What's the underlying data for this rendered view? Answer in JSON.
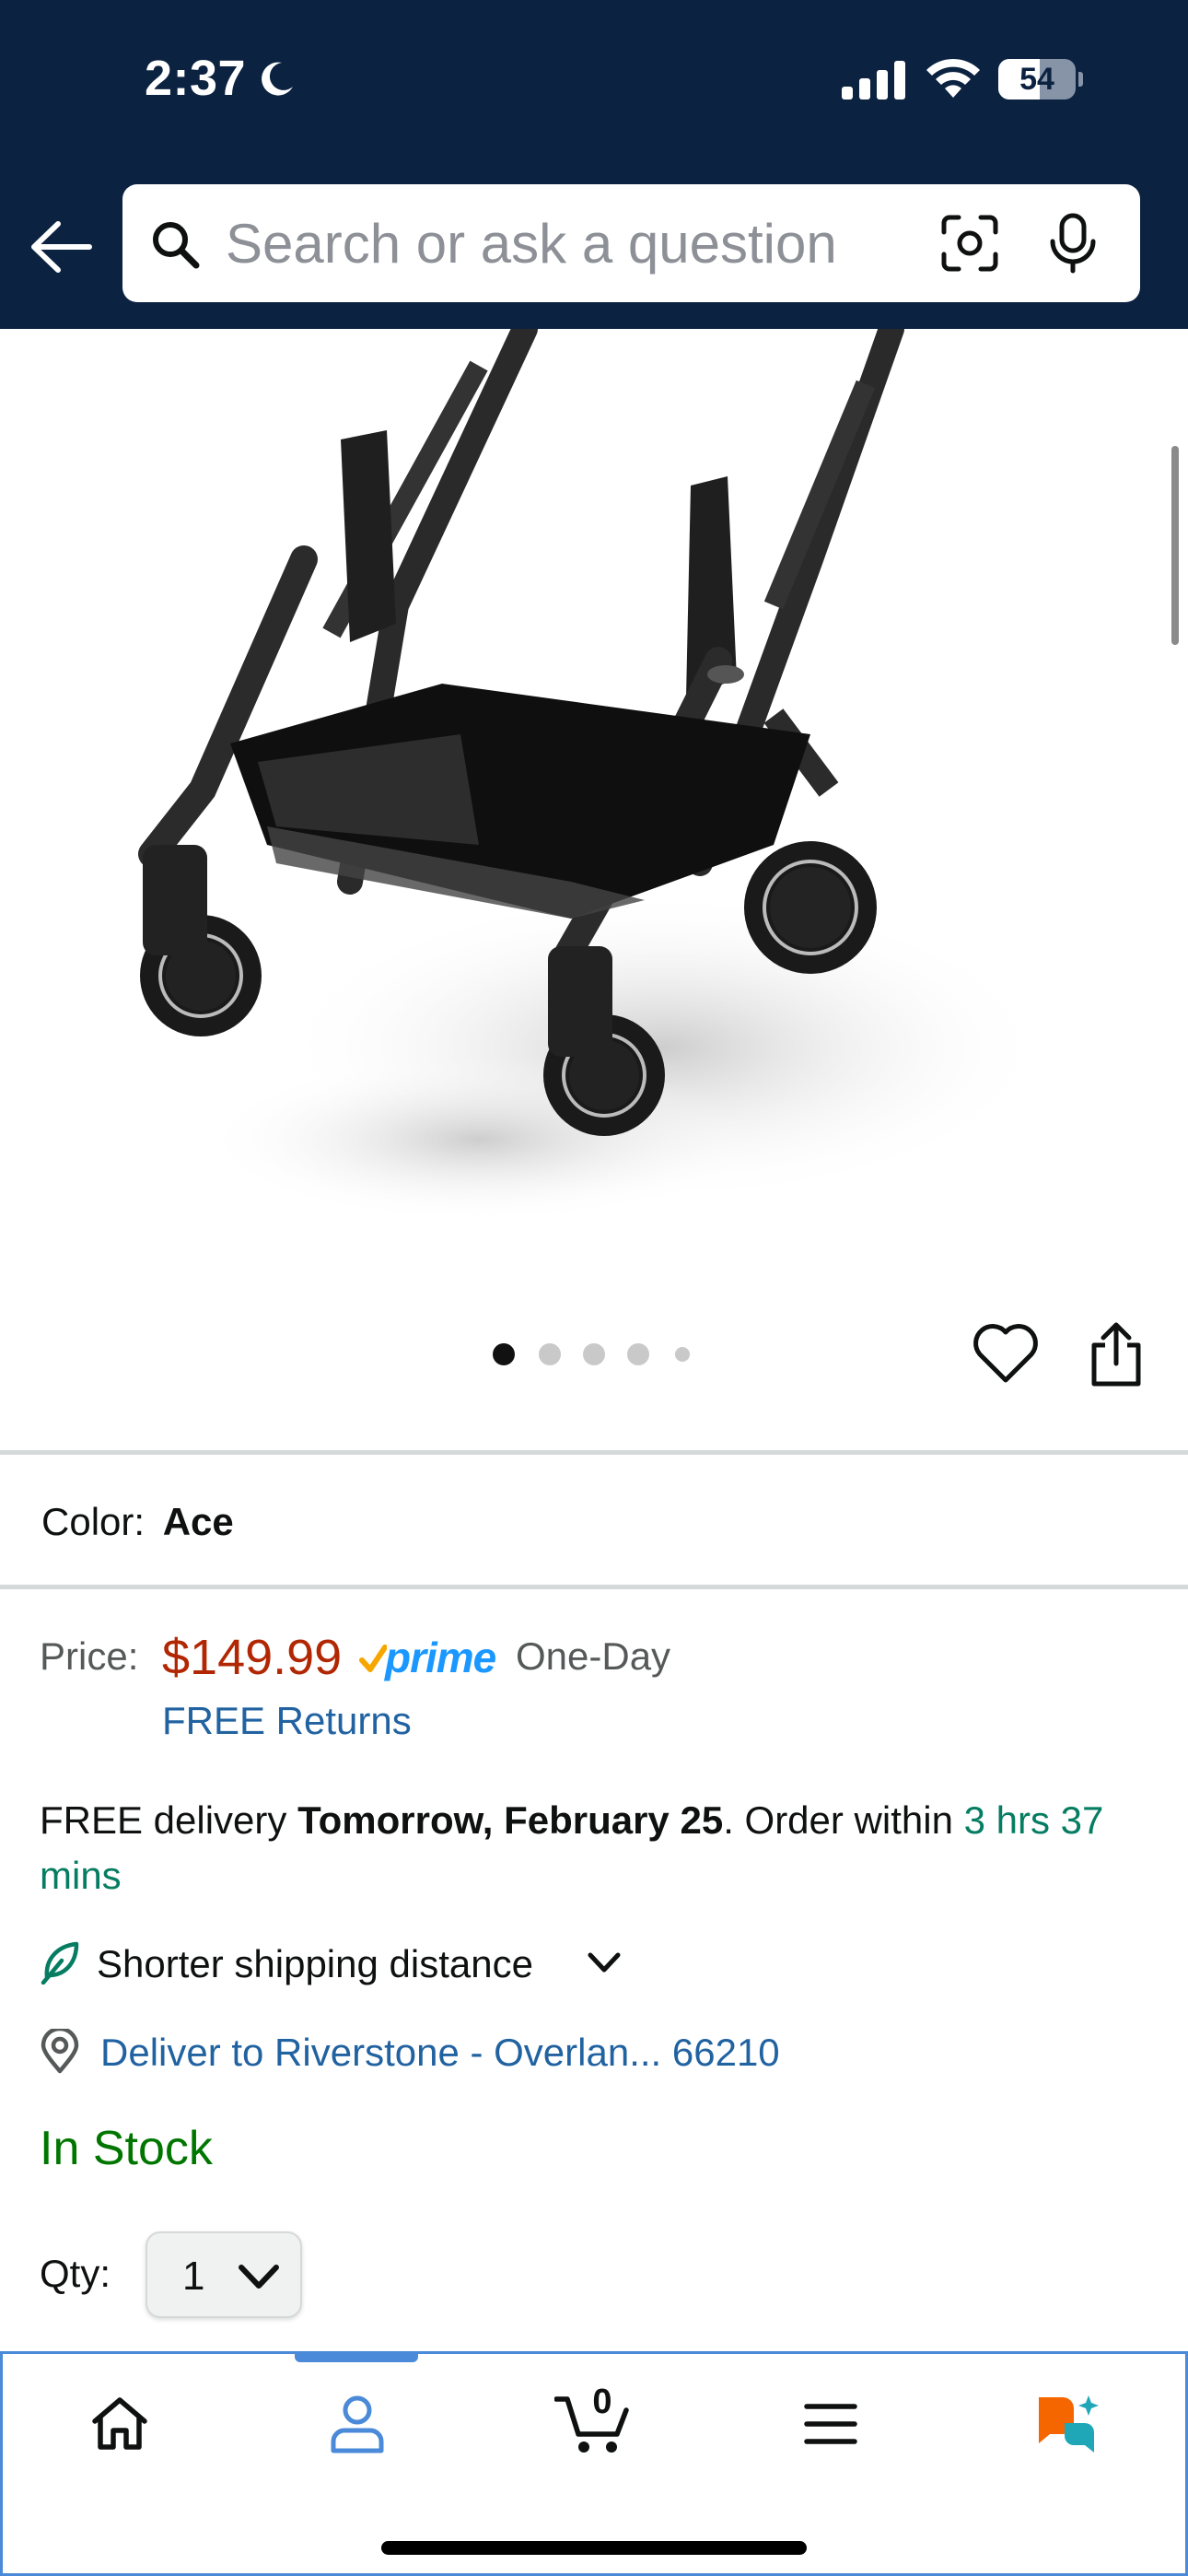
{
  "status_bar": {
    "time": "2:37",
    "battery": "54",
    "battery_level": 0.54
  },
  "search": {
    "placeholder": "Search or ask a question"
  },
  "gallery": {
    "image_count": 5,
    "active_index": 0
  },
  "product": {
    "color_label": "Color:",
    "color_value": "Ace"
  },
  "price": {
    "label": "Price:",
    "amount": "$149.99",
    "prime_label": "prime",
    "one_day": "One-Day",
    "free_returns": "FREE Returns"
  },
  "delivery": {
    "prefix": "FREE delivery ",
    "date": "Tomorrow, February 25",
    "middle": ". Order within ",
    "countdown": "3 hrs 37 mins"
  },
  "shipping": {
    "label": "Shorter shipping distance"
  },
  "deliver_to": {
    "label": "Deliver to Riverstone - Overlan... 66210"
  },
  "stock": {
    "status": "In Stock"
  },
  "quantity": {
    "label": "Qty:",
    "value": "1"
  },
  "bottom_nav": {
    "cart_count": "0",
    "active": "account"
  },
  "colors": {
    "header_bg": "#0c2241",
    "price_red": "#b12704",
    "link_blue": "#2162a1",
    "stock_green": "#007600",
    "prime_blue": "#1a98ff",
    "nav_active": "#4a8ad8"
  }
}
